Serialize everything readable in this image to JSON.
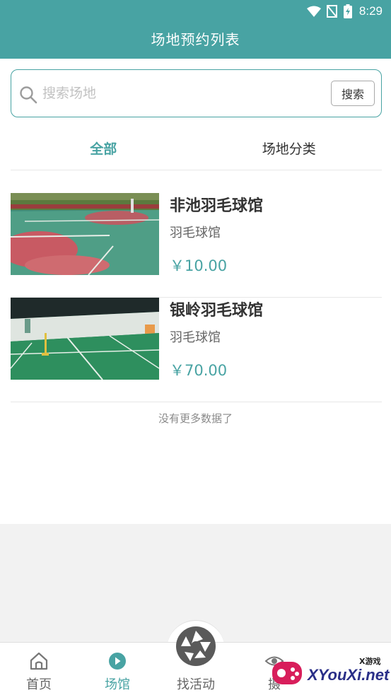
{
  "status_bar": {
    "time": "8:29",
    "icons": [
      "wifi-icon",
      "signal-off-icon",
      "battery-charging-icon"
    ]
  },
  "header": {
    "title": "场地预约列表"
  },
  "search": {
    "placeholder": "搜索场地",
    "value": "",
    "button_label": "搜索",
    "icon": "search-icon"
  },
  "tabs": [
    {
      "label": "全部",
      "active": true
    },
    {
      "label": "场地分类",
      "active": false
    }
  ],
  "venues": [
    {
      "name": "非池羽毛球馆",
      "type": "羽毛球馆",
      "price": "￥10.00"
    },
    {
      "name": "银岭羽毛球馆",
      "type": "羽毛球馆",
      "price": "￥70.00"
    }
  ],
  "list_footer": "没有更多数据了",
  "bottom_nav": [
    {
      "label": "首页",
      "icon": "home-icon",
      "active": false
    },
    {
      "label": "场馆",
      "icon": "play-circle-icon",
      "active": true
    },
    {
      "label": "找活动",
      "icon": "aperture-icon",
      "active": false
    },
    {
      "label": "摄",
      "icon": "eye-icon",
      "active": false
    }
  ],
  "watermark": {
    "text": "XYouXi.net",
    "small": "X游戏"
  },
  "colors": {
    "primary": "#48a3a3",
    "text": "#333333",
    "muted": "#666666",
    "background": "#f2f2f2"
  }
}
